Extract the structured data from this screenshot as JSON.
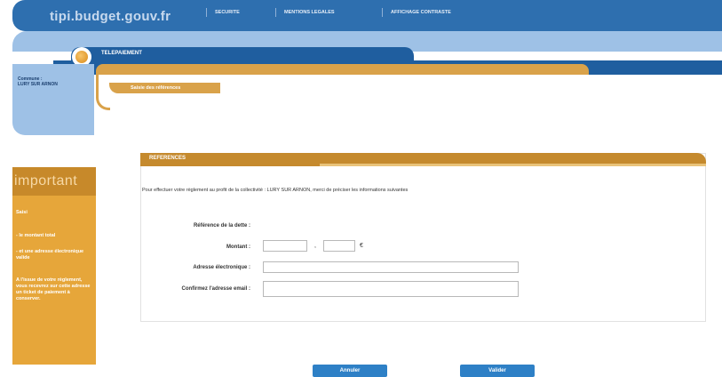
{
  "header": {
    "site_name": "tipi.budget.gouv.fr",
    "links": [
      "SECURITE",
      "MENTIONS LEGALES",
      "AFFICHAGE CONTRASTE"
    ]
  },
  "banner": {
    "section": "TELEPAIEMENT",
    "commune_label": "Commune :",
    "commune_name": "LURY SUR ARNON",
    "step": "Saisie des références"
  },
  "important": {
    "title": "important",
    "heading": "Saisi",
    "items": [
      "- le montant total",
      "- et une adresse électronique valide",
      "A l'issue de votre règlement, vous recevrez sur cette adresse un ticket de paiement à conserver."
    ]
  },
  "references": {
    "title": "REFERENCES",
    "intro": "Pour effectuer votre règlement au profit de la collectivité : LURY SUR ARNON, merci de préciser les informations suivantes",
    "fields": {
      "ref_label": "Référence de la dette :",
      "montant_label": "Montant :",
      "email_label": "Adresse électronique :",
      "confirm_label": "Confirmez l'adresse email :",
      "comma": ",",
      "currency": "€",
      "montant_int": "",
      "montant_dec": "",
      "email": "",
      "confirm": ""
    }
  },
  "buttons": {
    "prev": "Annuler",
    "next": "Valider"
  },
  "colors": {
    "brand_blue": "#2e6faf",
    "accent_orange": "#d9a24a"
  }
}
